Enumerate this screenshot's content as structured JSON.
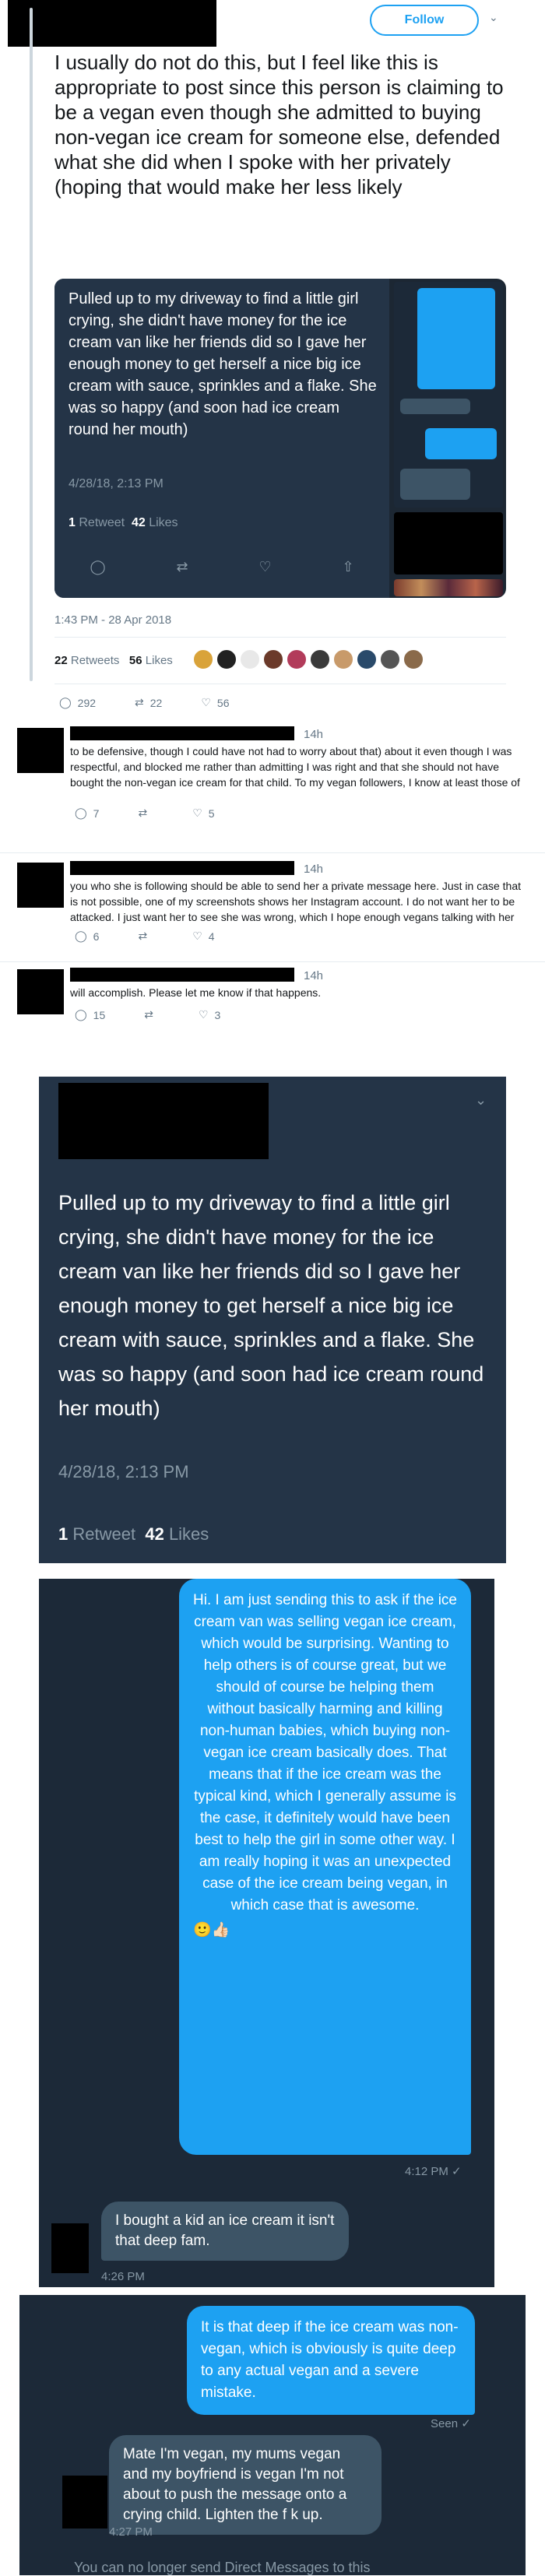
{
  "header": {
    "follow_label": "Follow",
    "chevron": "chevron-down-icon"
  },
  "tweet": {
    "text": "I usually do not do this, but I feel like this is appropriate to post since this person is claiming to be a vegan even though she admitted to buying non-vegan ice cream for someone else, defended what she did when I spoke with her privately (hoping that would make her less likely",
    "timestamp": "1:43 PM - 28 Apr 2018",
    "retweets_count": "22",
    "retweets_label": "Retweets",
    "likes_count": "56",
    "likes_label": "Likes",
    "actions": {
      "reply_count": "292",
      "retweet_count": "22",
      "like_count": "56"
    }
  },
  "embedded": {
    "text": "Pulled up to my driveway to find a little girl crying, she didn't have money for the ice cream van like her friends did so I gave her enough money to get herself a nice big ice cream with sauce, sprinkles and a flake. She was so happy (and soon had ice cream round her mouth)",
    "date": "4/28/18, 2:13 PM",
    "retweets_count": "1",
    "retweets_label": "Retweet",
    "likes_count": "42",
    "likes_label": "Likes"
  },
  "replies": [
    {
      "time": "14h",
      "text": "to be defensive, though I could have not had to worry about that) about it even though I was respectful, and blocked me rather than admitting I was right and that she should not have bought the non-vegan ice cream for that child. To my vegan followers, I know at least those of",
      "reply_count": "7",
      "retweet_count": "",
      "like_count": "5"
    },
    {
      "time": "14h",
      "text": "you who she is following should be able to send her a private message here. Just in case that is not possible, one of my screenshots shows her Instagram account. I do not want her to be attacked. I just want her to see she was wrong, which I hope enough vegans talking with her",
      "reply_count": "6",
      "retweet_count": "",
      "like_count": "4"
    },
    {
      "time": "14h",
      "text": "will accomplish. Please let me know if that happens.",
      "reply_count": "15",
      "retweet_count": "",
      "like_count": "3"
    }
  ],
  "screenshot_tweet": {
    "text": "Pulled up to my driveway to find a little girl crying, she didn't have money for the ice cream van like her friends did so I gave her enough money to get herself a nice big ice cream with sauce, sprinkles and a flake. She was so happy (and soon had ice cream round her mouth)",
    "date": "4/28/18, 2:13 PM",
    "retweets_count": "1",
    "retweets_label": "Retweet",
    "likes_count": "42",
    "likes_label": "Likes"
  },
  "dm1": {
    "outgoing": "Hi. I am just sending this to ask if the ice cream van was selling vegan ice cream, which would be surprising. Wanting to help others is of course great, but we should of course be helping them without basically harming and killing non-human babies, which buying non-vegan ice cream basically does. That means that if the ice cream was the typical kind, which I generally assume is the case, it definitely would have been best to help the girl in some other way. I am really hoping it was an unexpected case of the ice cream being vegan, in which case that is awesome.",
    "outgoing_emoji": "🙂👍🏻",
    "outgoing_time": "4:12 PM ✓",
    "incoming": "I bought a kid an ice cream it isn't that deep fam.",
    "incoming_time": "4:26 PM"
  },
  "dm2": {
    "outgoing": "It is that deep if the ice cream was non-vegan, which is obviously is quite deep to any actual vegan and a severe mistake.",
    "seen": "Seen ✓",
    "incoming": "Mate I'm vegan, my mums vegan and my boyfriend is vegan I'm not about to push the message onto a crying child. Lighten the f   k up.",
    "incoming_time": "4:27 PM",
    "footer": "You can no longer send Direct Messages to this"
  },
  "colors": {
    "twitter_blue": "#1da1f2",
    "dark_bg": "#243447",
    "dark_bg2": "#1c2938",
    "incoming_bubble": "#3d5466"
  },
  "icons": [
    "reply-icon",
    "retweet-icon",
    "heart-icon",
    "share-icon",
    "chevron-down-icon",
    "checkmark-icon"
  ]
}
